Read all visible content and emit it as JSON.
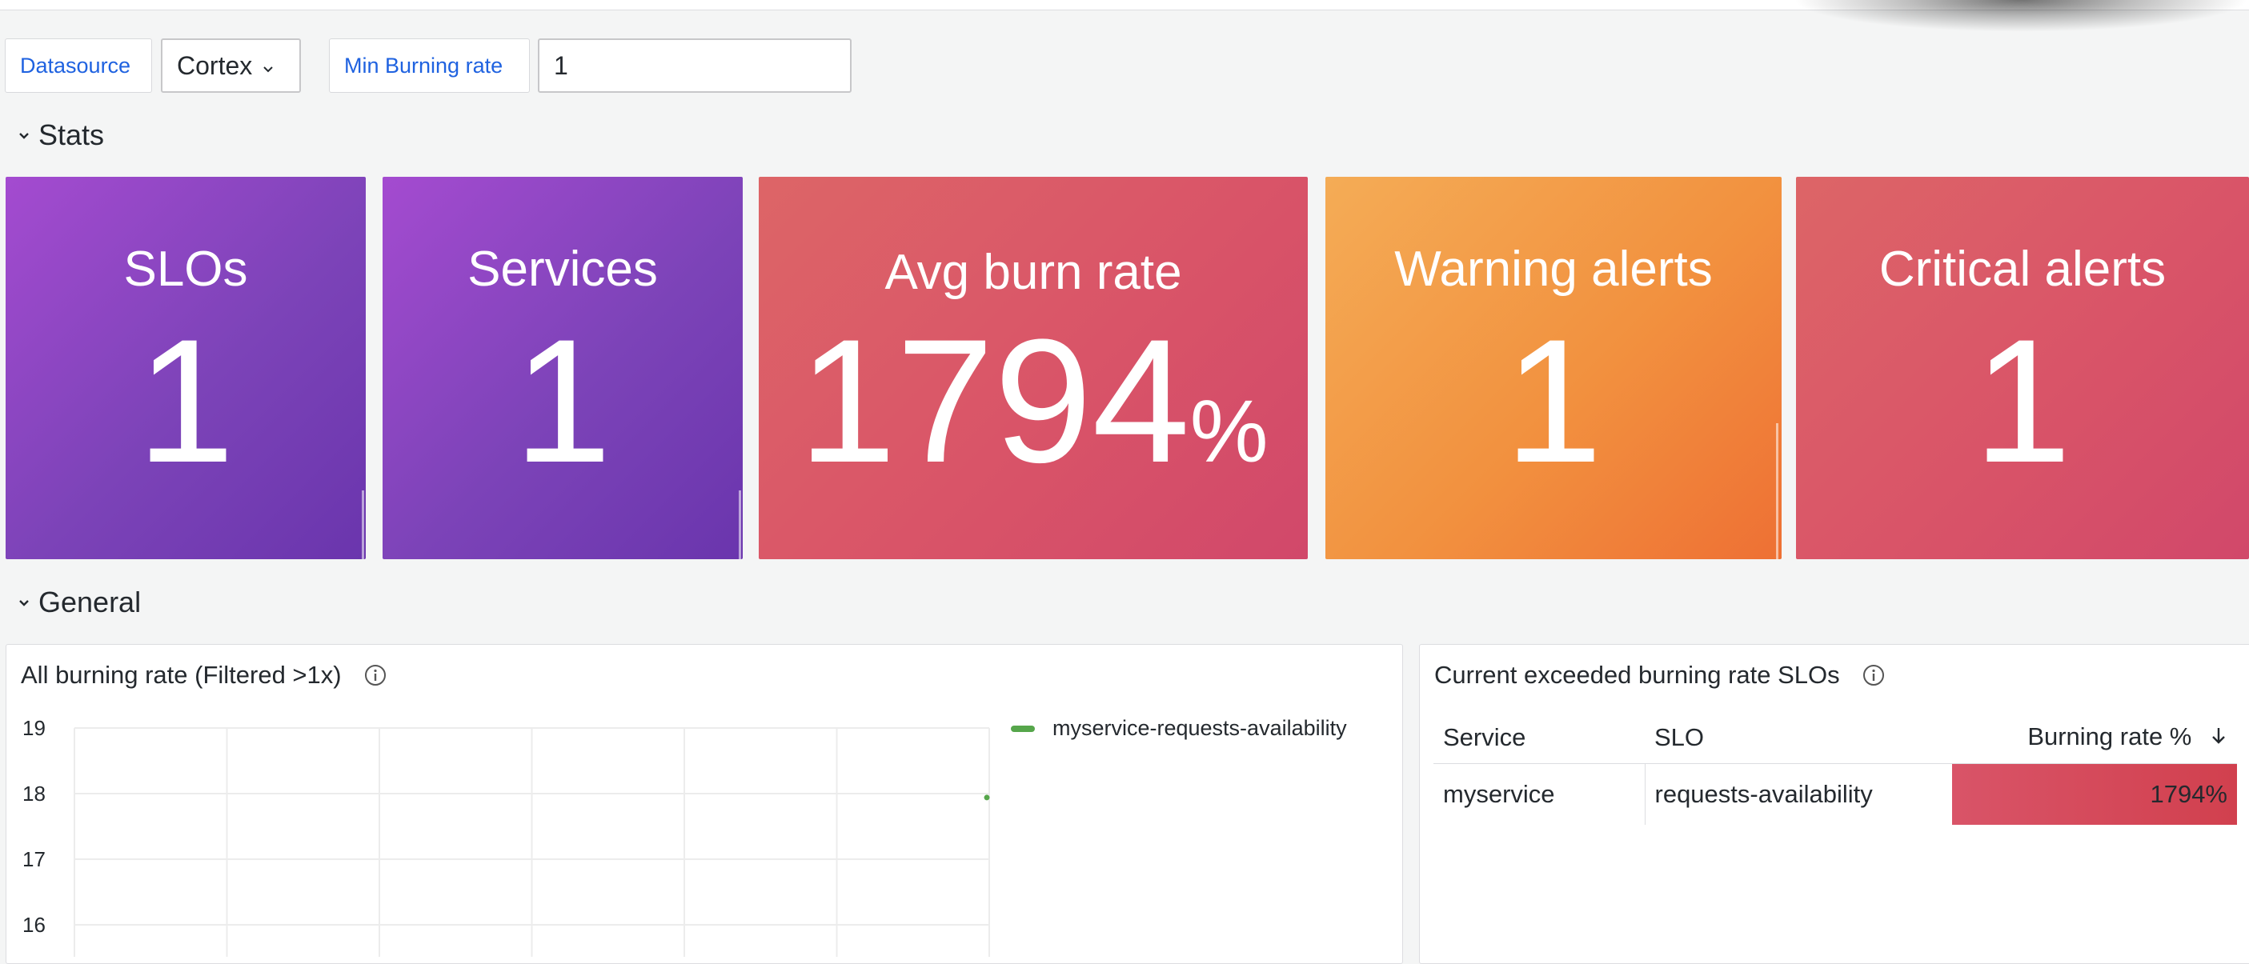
{
  "variables": {
    "datasource_label": "Datasource",
    "datasource_value": "Cortex",
    "min_burning_label": "Min Burning rate",
    "min_burning_value": "1"
  },
  "rows": {
    "stats_title": "Stats",
    "general_title": "General"
  },
  "stats": [
    {
      "title": "SLOs",
      "value": "1",
      "unit": "",
      "color": "#8a42c0"
    },
    {
      "title": "Services",
      "value": "1",
      "unit": "",
      "color": "#8a42c0"
    },
    {
      "title": "Avg burn rate",
      "value": "1794",
      "unit": "%",
      "color": "#d95468"
    },
    {
      "title": "Warning alerts",
      "value": "1",
      "unit": "",
      "color": "#f2913f"
    },
    {
      "title": "Critical alerts",
      "value": "1",
      "unit": "",
      "color": "#d95468"
    }
  ],
  "burn_panel": {
    "title": "All burning rate (Filtered >1x)",
    "legend": "myservice-requests-availability",
    "series_color": "#56a64b"
  },
  "chart_data": {
    "type": "line",
    "title": "All burning rate (Filtered >1x)",
    "xlabel": "",
    "ylabel": "",
    "y_ticks": [
      "19",
      "18",
      "17",
      "16"
    ],
    "ylim": [
      15.5,
      19
    ],
    "grid": true,
    "legend_position": "right",
    "series": [
      {
        "name": "myservice-requests-availability",
        "x": [
          "last"
        ],
        "values": [
          17.94
        ]
      }
    ]
  },
  "table_panel": {
    "title": "Current exceeded burning rate SLOs",
    "headers": [
      "Service",
      "SLO",
      "Burning rate %"
    ],
    "rows": [
      [
        "myservice",
        "requests-availability",
        "1794%"
      ]
    ]
  }
}
